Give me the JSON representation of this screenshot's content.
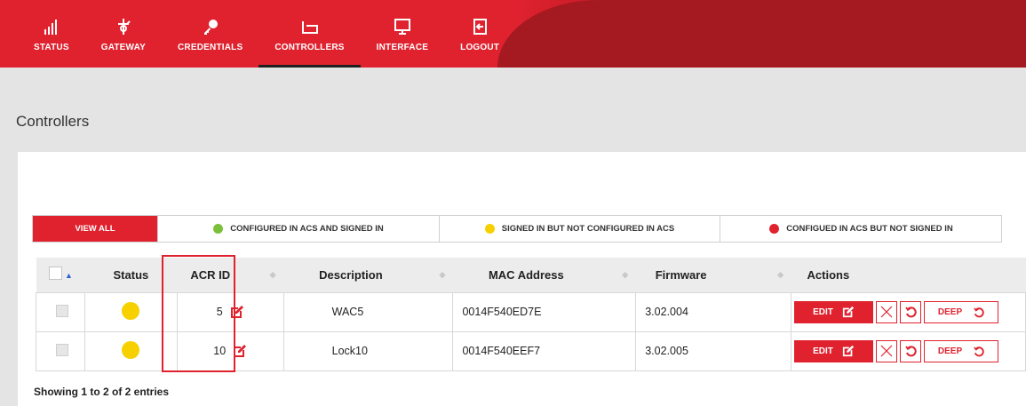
{
  "nav": {
    "items": [
      {
        "label": "STATUS",
        "icon": "signal-bars-icon"
      },
      {
        "label": "GATEWAY",
        "icon": "gateway-icon"
      },
      {
        "label": "CREDENTIALS",
        "icon": "key-icon"
      },
      {
        "label": "CONTROLLERS",
        "icon": "controller-icon",
        "active": true
      },
      {
        "label": "INTERFACE",
        "icon": "monitor-icon"
      },
      {
        "label": "LOGOUT",
        "icon": "logout-icon"
      }
    ]
  },
  "page": {
    "title": "Controllers"
  },
  "filters": [
    {
      "label": "VIEW ALL",
      "active": true
    },
    {
      "label": "CONFIGURED IN ACS AND SIGNED IN",
      "dot_color": "#7cbf3a"
    },
    {
      "label": "SIGNED IN BUT NOT CONFIGURED IN ACS",
      "dot_color": "#f7d000"
    },
    {
      "label": "CONFIGUED IN ACS BUT NOT SIGNED IN",
      "dot_color": "#e0222f"
    }
  ],
  "table": {
    "columns": [
      "Status",
      "ACR ID",
      "Description",
      "MAC Address",
      "Firmware",
      "Actions"
    ],
    "rows": [
      {
        "status_color": "#f7d000",
        "acr_id": "5",
        "description": "WAC5",
        "mac": "0014F540ED7E",
        "firmware": "3.02.004"
      },
      {
        "status_color": "#f7d000",
        "acr_id": "10",
        "description": "Lock10",
        "mac": "0014F540EEF7",
        "firmware": "3.02.005"
      }
    ],
    "actions": {
      "edit_label": "EDIT",
      "deep_label": "DEEP"
    }
  },
  "footer": {
    "entries": "Showing 1 to 2 of 2 entries"
  },
  "colors": {
    "accent": "#e0222f",
    "dark_accent": "#a51a21"
  }
}
